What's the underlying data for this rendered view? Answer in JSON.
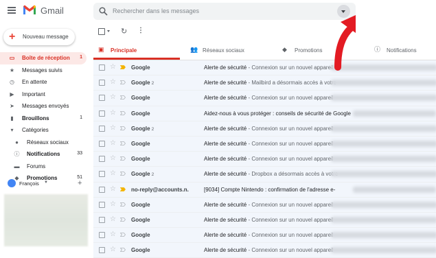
{
  "header": {
    "logo_text": "Gmail",
    "search_placeholder": "Rechercher dans les messages"
  },
  "sidebar": {
    "compose_label": "Nouveau message",
    "items": [
      {
        "label": "Boîte de réception",
        "count": "1",
        "icon": "inbox-icon",
        "glyph": "▭",
        "active": true,
        "bold": true,
        "sub": false
      },
      {
        "label": "Messages suivis",
        "count": "",
        "icon": "star-icon",
        "glyph": "★",
        "active": false,
        "bold": false,
        "sub": false
      },
      {
        "label": "En attente",
        "count": "",
        "icon": "clock-icon",
        "glyph": "◷",
        "active": false,
        "bold": false,
        "sub": false
      },
      {
        "label": "Important",
        "count": "",
        "icon": "important-icon",
        "glyph": "▶",
        "active": false,
        "bold": false,
        "sub": false
      },
      {
        "label": "Messages envoyés",
        "count": "",
        "icon": "send-icon",
        "glyph": "➤",
        "active": false,
        "bold": false,
        "sub": false
      },
      {
        "label": "Brouillons",
        "count": "1",
        "icon": "draft-icon",
        "glyph": "▮",
        "active": false,
        "bold": true,
        "sub": false
      },
      {
        "label": "Catégories",
        "count": "",
        "icon": "label-icon",
        "glyph": "▾",
        "active": false,
        "bold": false,
        "sub": false
      },
      {
        "label": "Réseaux sociaux",
        "count": "",
        "icon": "people-icon",
        "glyph": "●",
        "active": false,
        "bold": false,
        "sub": true
      },
      {
        "label": "Notifications",
        "count": "33",
        "icon": "info-icon",
        "glyph": "ⓘ",
        "active": false,
        "bold": true,
        "sub": true
      },
      {
        "label": "Forums",
        "count": "",
        "icon": "forum-icon",
        "glyph": "▬",
        "active": false,
        "bold": false,
        "sub": true
      },
      {
        "label": "Promotions",
        "count": "51",
        "icon": "tag-icon",
        "glyph": "◆",
        "active": false,
        "bold": true,
        "sub": true
      }
    ],
    "user_name": "François"
  },
  "tabs": [
    {
      "label": "Principale",
      "icon": "inbox-icon",
      "glyph": "▣",
      "active": true
    },
    {
      "label": "Réseaux sociaux",
      "icon": "people-icon",
      "glyph": "👥",
      "active": false
    },
    {
      "label": "Promotions",
      "icon": "tag-icon",
      "glyph": "◆",
      "active": false
    },
    {
      "label": "Notifications",
      "icon": "info-icon",
      "glyph": "ⓘ",
      "active": false
    }
  ],
  "colors": {
    "accent": "#d93025",
    "important_marker": "#f4b400"
  },
  "messages": [
    {
      "sender": "Google",
      "count": "",
      "subject": "Alerte de sécurité",
      "snippet": " - Connexion sur un nouvel appareil",
      "important": true
    },
    {
      "sender": "Google",
      "count": "2",
      "subject": "Alerte de sécurité",
      "snippet": " - Mailbird a désormais accès à votre",
      "important": false
    },
    {
      "sender": "Google",
      "count": "",
      "subject": "Alerte de sécurité",
      "snippet": " - Connexion sur un nouvel appareil",
      "important": false
    },
    {
      "sender": "Google",
      "count": "",
      "subject": "Aidez-nous à vous protéger : conseils de sécurité de Google",
      "snippet": "",
      "important": false
    },
    {
      "sender": "Google",
      "count": "2",
      "subject": "Alerte de sécurité",
      "snippet": " - Connexion sur un nouvel appareil",
      "important": false
    },
    {
      "sender": "Google",
      "count": "",
      "subject": "Alerte de sécurité",
      "snippet": " - Connexion sur un nouvel appareil",
      "important": false
    },
    {
      "sender": "Google",
      "count": "",
      "subject": "Alerte de sécurité",
      "snippet": " - Connexion sur un nouvel appareil",
      "important": false
    },
    {
      "sender": "Google",
      "count": "2",
      "subject": "Alerte de sécurité",
      "snippet": " - Dropbox a désormais accès à votre",
      "important": false
    },
    {
      "sender": "no-reply@accounts.n.",
      "count": "",
      "subject": "[9034] Compte Nintendo : confirmation de l'adresse e-",
      "snippet": "",
      "important": true
    },
    {
      "sender": "Google",
      "count": "",
      "subject": "Alerte de sécurité",
      "snippet": " - Connexion sur un nouvel appareil",
      "important": false
    },
    {
      "sender": "Google",
      "count": "",
      "subject": "Alerte de sécurité",
      "snippet": " - Connexion sur un nouvel appareil",
      "important": false
    },
    {
      "sender": "Google",
      "count": "",
      "subject": "Alerte de sécurité",
      "snippet": " - Connexion sur un nouvel appareil",
      "important": false
    },
    {
      "sender": "Google",
      "count": "",
      "subject": "Alerte de sécurité",
      "snippet": " - Connexion sur un nouvel appareil",
      "important": false
    }
  ]
}
